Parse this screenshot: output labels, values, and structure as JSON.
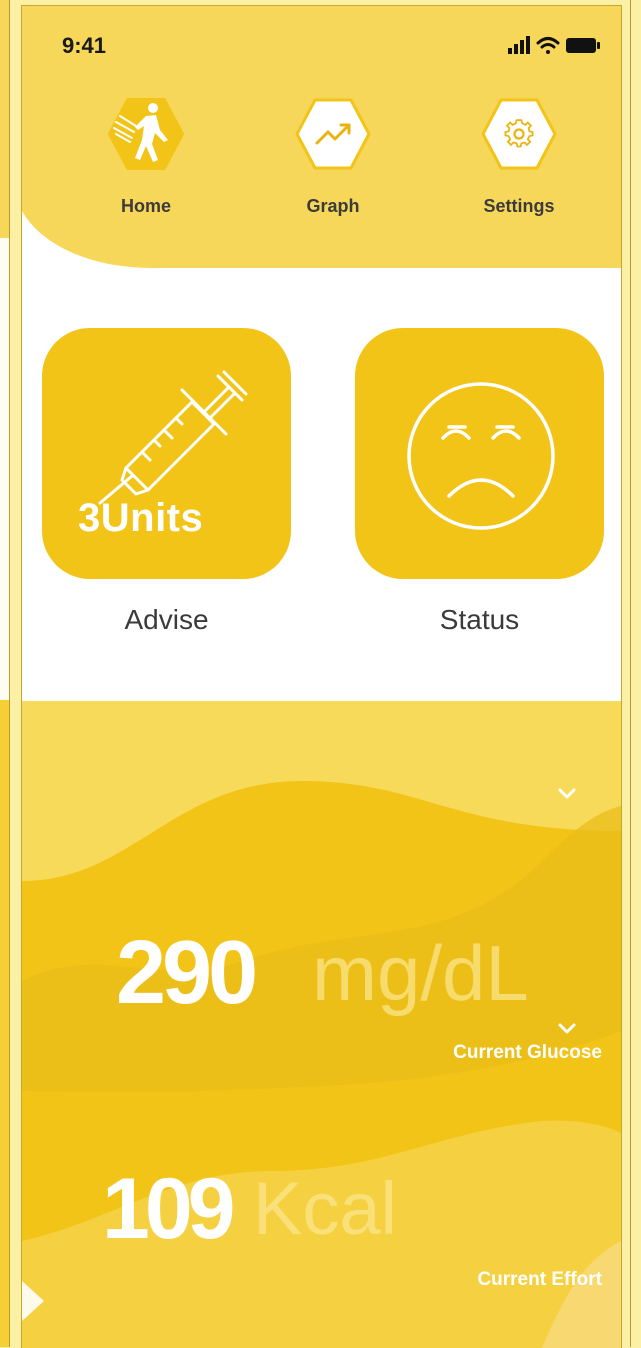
{
  "status_bar": {
    "time": "9:41"
  },
  "nav": {
    "items": [
      {
        "label": "Home",
        "icon": "runner-icon",
        "active": true
      },
      {
        "label": "Graph",
        "icon": "trend-up-icon",
        "active": false
      },
      {
        "label": "Settings",
        "icon": "gear-icon",
        "active": false
      }
    ]
  },
  "tiles": {
    "advise": {
      "caption": "Advise",
      "units_text": "3Units",
      "icon": "syringe-icon"
    },
    "status": {
      "caption": "Status",
      "icon": "sad-face-icon"
    }
  },
  "metrics": {
    "glucose": {
      "value": "290",
      "unit": "mg/dL",
      "label": "Current Glucose"
    },
    "effort": {
      "value": "109",
      "unit": "Kcal",
      "label": "Current Effort"
    }
  },
  "colors": {
    "primary": "#f2c417",
    "header": "#f7d75a",
    "accent_dark": "#e9b40f",
    "background": "#fbf0a6"
  }
}
